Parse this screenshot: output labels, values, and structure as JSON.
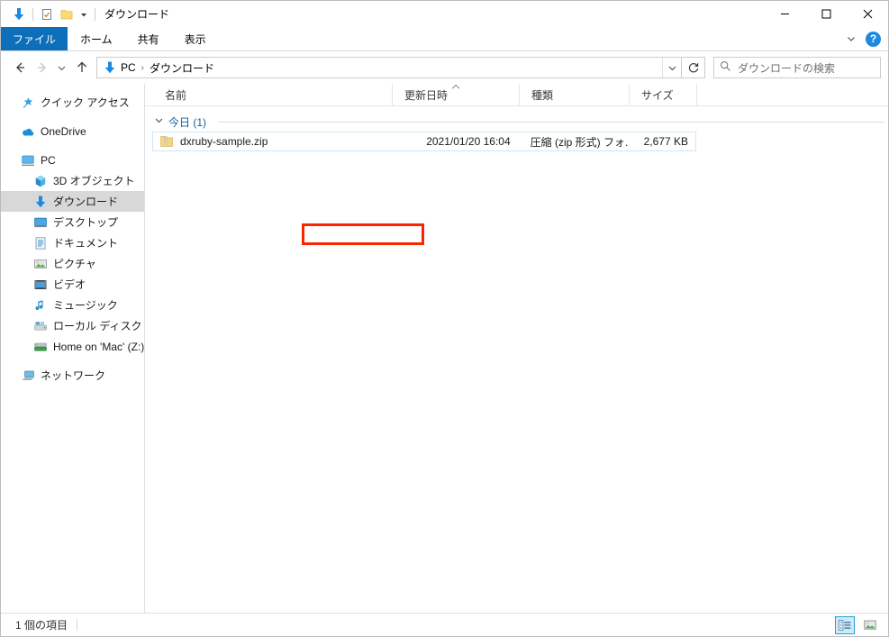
{
  "window": {
    "title": "ダウンロード",
    "quick_access_icons": [
      "download-icon",
      "properties-icon",
      "new-folder-icon",
      "customize-caret-icon"
    ],
    "controls": {
      "minimize": "minimize-icon",
      "maximize": "maximize-icon",
      "close": "close-icon"
    }
  },
  "ribbon": {
    "tabs": [
      {
        "label": "ファイル",
        "active": true
      },
      {
        "label": "ホーム",
        "active": false
      },
      {
        "label": "共有",
        "active": false
      },
      {
        "label": "表示",
        "active": false
      }
    ],
    "expand_icon": "chevron-down-icon",
    "help_label": "?"
  },
  "address": {
    "back_icon": "back-arrow-icon",
    "forward_icon": "forward-arrow-icon",
    "recent_icon": "chevron-down-icon",
    "up_icon": "up-arrow-icon",
    "path_icon": "download-folder-icon",
    "crumbs": [
      "PC",
      "ダウンロード"
    ],
    "separator": "›",
    "dropdown_icon": "chevron-down-icon",
    "refresh_icon": "refresh-icon"
  },
  "search": {
    "icon": "search-icon",
    "placeholder": "ダウンロードの検索",
    "value": ""
  },
  "sidebar": {
    "items": [
      {
        "label": "クイック アクセス",
        "icon": "star-pin-icon",
        "level": 0,
        "selected": false,
        "gap_before": false
      },
      {
        "label": "OneDrive",
        "icon": "onedrive-cloud-icon",
        "level": 0,
        "selected": false,
        "gap_before": true
      },
      {
        "label": "PC",
        "icon": "pc-monitor-icon",
        "level": 0,
        "selected": false,
        "gap_before": true
      },
      {
        "label": "3D オブジェクト",
        "icon": "3d-object-icon",
        "level": 1,
        "selected": false,
        "gap_before": false
      },
      {
        "label": "ダウンロード",
        "icon": "download-folder-icon",
        "level": 1,
        "selected": true,
        "gap_before": false
      },
      {
        "label": "デスクトップ",
        "icon": "desktop-icon",
        "level": 1,
        "selected": false,
        "gap_before": false
      },
      {
        "label": "ドキュメント",
        "icon": "documents-icon",
        "level": 1,
        "selected": false,
        "gap_before": false
      },
      {
        "label": "ピクチャ",
        "icon": "pictures-icon",
        "level": 1,
        "selected": false,
        "gap_before": false
      },
      {
        "label": "ビデオ",
        "icon": "videos-icon",
        "level": 1,
        "selected": false,
        "gap_before": false
      },
      {
        "label": "ミュージック",
        "icon": "music-note-icon",
        "level": 1,
        "selected": false,
        "gap_before": false
      },
      {
        "label": "ローカル ディスク (C:)",
        "icon": "local-disk-icon",
        "level": 1,
        "selected": false,
        "gap_before": false
      },
      {
        "label": "Home on 'Mac' (Z:)",
        "icon": "network-drive-icon",
        "level": 1,
        "selected": false,
        "gap_before": false
      },
      {
        "label": "ネットワーク",
        "icon": "network-icon",
        "level": 0,
        "selected": false,
        "gap_before": true
      }
    ]
  },
  "filelist": {
    "columns": [
      {
        "key": "name",
        "label": "名前",
        "sorted": false
      },
      {
        "key": "date",
        "label": "更新日時",
        "sorted": true,
        "sort_icon": "chevron-up-icon"
      },
      {
        "key": "type",
        "label": "種類",
        "sorted": false
      },
      {
        "key": "size",
        "label": "サイズ",
        "sorted": false
      }
    ],
    "groups": [
      {
        "label": "今日 (1)",
        "chevron": "chevron-down-icon",
        "rows": [
          {
            "icon": "zip-folder-icon",
            "name": "dxruby-sample.zip",
            "date": "2021/01/20 16:04",
            "type": "圧縮 (zip 形式) フォ...",
            "size": "2,677 KB",
            "annotated": true
          }
        ]
      }
    ]
  },
  "statusbar": {
    "item_count": "1 個の項目",
    "views": [
      {
        "icon": "details-view-icon",
        "active": true
      },
      {
        "icon": "large-icons-view-icon",
        "active": false
      }
    ]
  },
  "colors": {
    "accent": "#0d6eba",
    "annotation": "#fa2600",
    "selection": "#d8d8d8",
    "row_focus_border": "#cde8f7",
    "group_header_text": "#15609e"
  }
}
